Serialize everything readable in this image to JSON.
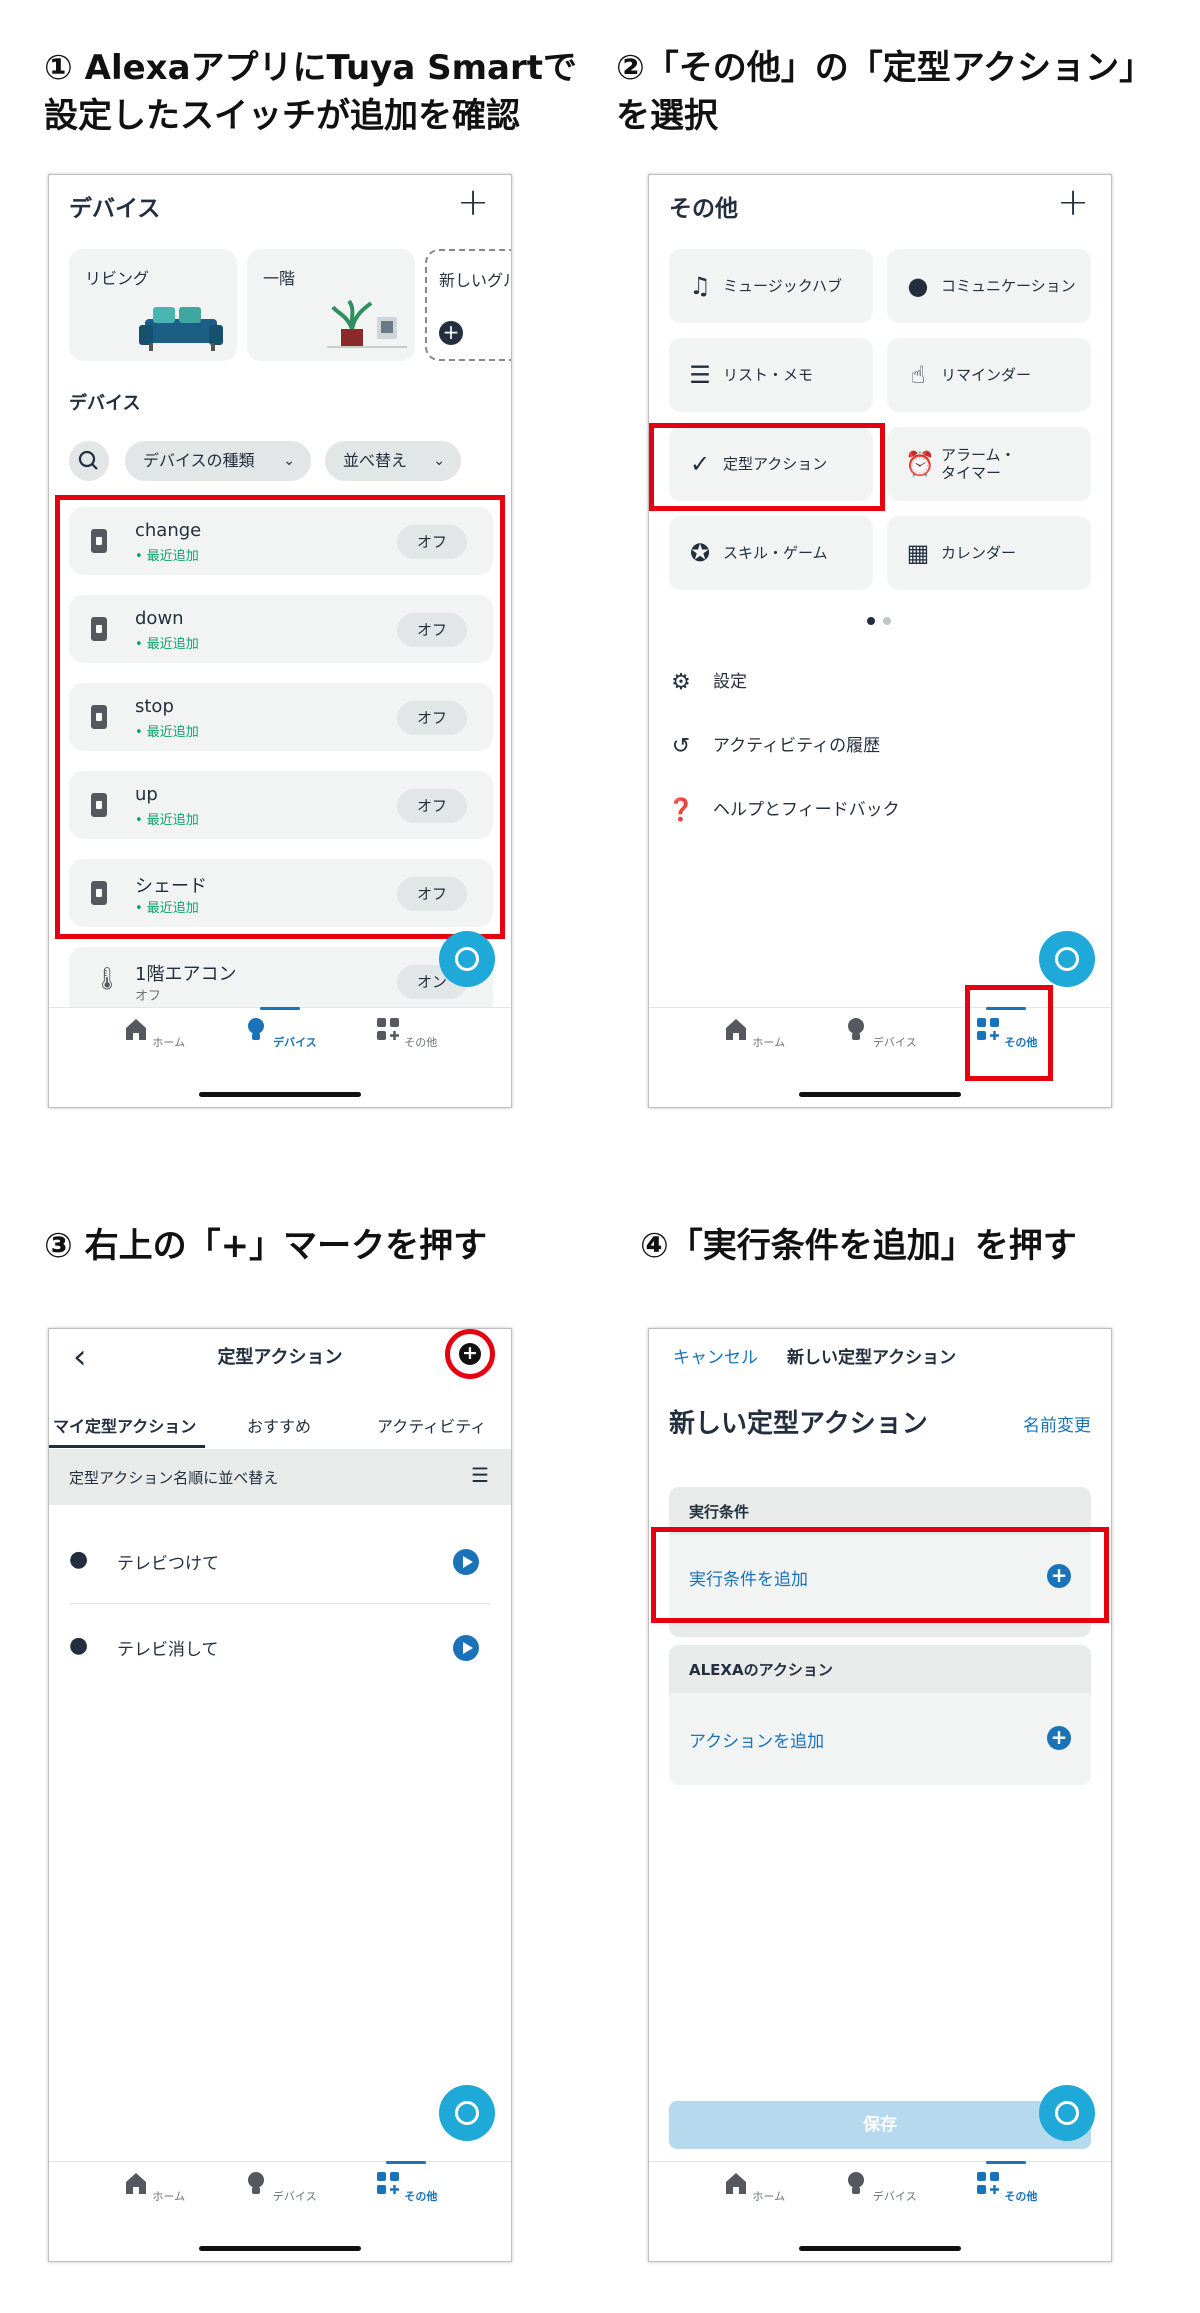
{
  "steps": {
    "s1": "① AlexaアプリにTuya Smartで\n設定したスイッチが追加を確認",
    "s2": "②「その他」の「定型アクション」\nを選択",
    "s3": "③ 右上の「+」マークを押す",
    "s4": "④「実行条件を追加」を押す"
  },
  "tabbar": {
    "home": "ホーム",
    "devices": "デバイス",
    "more": "その他"
  },
  "screen1": {
    "title": "デバイス",
    "groups": [
      "リビング",
      "一階",
      "新しいグル"
    ],
    "section": "デバイス",
    "filter_type": "デバイスの種類",
    "filter_sort": "並べ替え",
    "devices": [
      {
        "name": "change",
        "status": "• 最近追加",
        "state": "オフ"
      },
      {
        "name": "down",
        "status": "• 最近追加",
        "state": "オフ"
      },
      {
        "name": "stop",
        "status": "• 最近追加",
        "state": "オフ"
      },
      {
        "name": "up",
        "status": "• 最近追加",
        "state": "オフ"
      },
      {
        "name": "シェード",
        "status": "• 最近追加",
        "state": "オフ"
      }
    ],
    "extra_device": {
      "name": "1階エアコン",
      "status": "オフ",
      "state": "オン"
    }
  },
  "screen2": {
    "title": "その他",
    "tiles": [
      "ミュージックハブ",
      "コミュニケーション",
      "リスト・メモ",
      "リマインダー",
      "定型アクション",
      "アラーム・\nタイマー",
      "スキル・ゲーム",
      "カレンダー"
    ],
    "list": [
      "設定",
      "アクティビティの履歴",
      "ヘルプとフィードバック"
    ]
  },
  "screen3": {
    "title": "定型アクション",
    "tabs": [
      "マイ定型アクション",
      "おすすめ",
      "アクティビティ"
    ],
    "sort_label": "定型アクション名順に並べ替え",
    "routines": [
      "テレビつけて",
      "テレビ消して"
    ]
  },
  "screen4": {
    "cancel": "キャンセル",
    "header": "新しい定型アクション",
    "heading": "新しい定型アクション",
    "rename": "名前変更",
    "cond_section": "実行条件",
    "cond_add": "実行条件を追加",
    "action_section": "ALEXAのアクション",
    "action_add": "アクションを追加",
    "save": "保存"
  },
  "colors": {
    "accent": "#1a73b8",
    "highlight": "#e5010f",
    "alexa": "#1fa9d8",
    "recent": "#0e9f6e"
  }
}
